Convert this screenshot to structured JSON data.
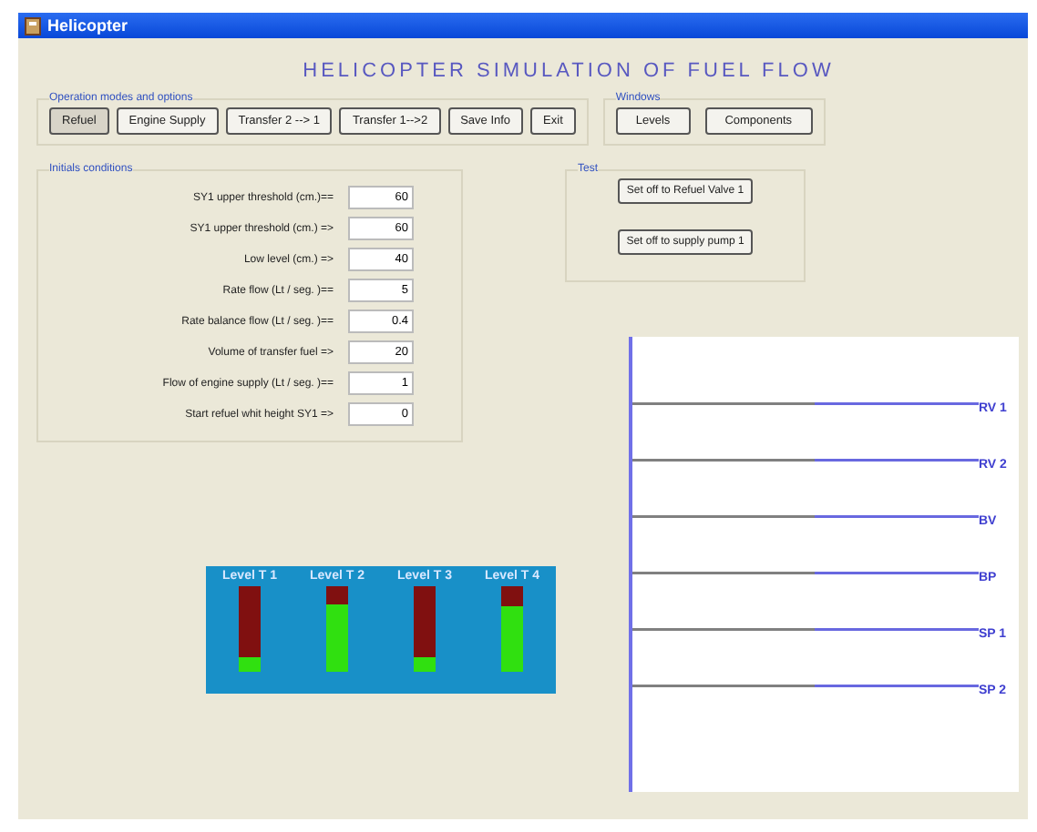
{
  "window": {
    "title": "Helicopter"
  },
  "heading": "HELICOPTER SIMULATION OF FUEL FLOW",
  "operation": {
    "title": "Operation modes and options",
    "buttons": [
      {
        "label": "Refuel",
        "selected": true
      },
      {
        "label": "Engine Supply",
        "selected": false
      },
      {
        "label": "Transfer 2 --> 1",
        "selected": false
      },
      {
        "label": "Transfer 1-->2",
        "selected": false
      },
      {
        "label": "Save Info",
        "selected": false
      },
      {
        "label": "Exit",
        "selected": false
      }
    ]
  },
  "windows": {
    "title": "Windows",
    "buttons": [
      "Levels",
      "Components"
    ]
  },
  "initial_conditions": {
    "title": "Initials conditions",
    "fields": [
      {
        "label": "SY1 upper threshold (cm.)==",
        "value": "60"
      },
      {
        "label": "SY1 upper threshold (cm.) =>",
        "value": "60"
      },
      {
        "label": "Low level (cm.) =>",
        "value": "40"
      },
      {
        "label": "Rate flow (Lt / seg. )==",
        "value": "5"
      },
      {
        "label": "Rate balance flow (Lt / seg. )==",
        "value": "0.4"
      },
      {
        "label": "Volume of transfer fuel =>",
        "value": "20"
      },
      {
        "label": "Flow of engine supply (Lt / seg. )==",
        "value": "1"
      },
      {
        "label": "Start refuel whit height SY1 =>",
        "value": "0"
      }
    ]
  },
  "test": {
    "title": "Test",
    "buttons": [
      "Set off to Refuel Valve 1",
      "Set off to supply pump 1"
    ]
  },
  "tanks": [
    {
      "label": "Level T 1",
      "level": 0.18
    },
    {
      "label": "Level T 2",
      "level": 0.79
    },
    {
      "label": "Level T 3",
      "level": 0.18
    },
    {
      "label": "Level T 4",
      "level": 0.76
    }
  ],
  "signals": [
    {
      "label": "RV 1"
    },
    {
      "label": "RV 2"
    },
    {
      "label": "BV"
    },
    {
      "label": "BP"
    },
    {
      "label": "SP 1"
    },
    {
      "label": "SP 2"
    }
  ]
}
